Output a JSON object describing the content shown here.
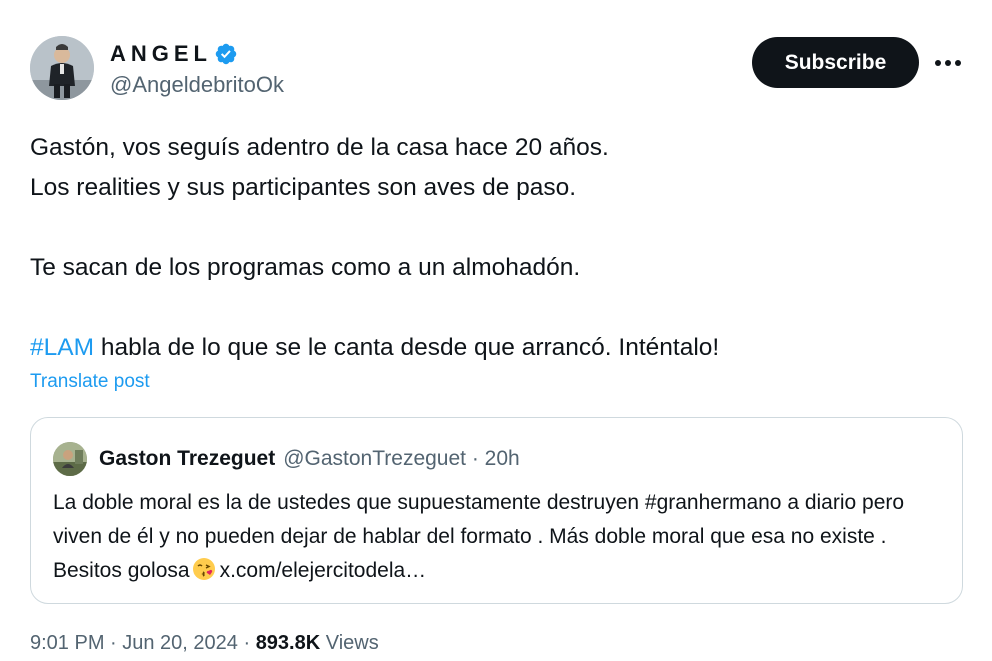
{
  "author": {
    "display_name": "ANGEL",
    "handle": "@AngeldebritoOk",
    "verified": true,
    "avatar_icon": "profile-photo-man-standing"
  },
  "actions": {
    "subscribe_label": "Subscribe",
    "more_icon": "more-horizontal-icon"
  },
  "post": {
    "lines": [
      "Gastón, vos seguís adentro de la casa hace 20 años.",
      "Los realities y sus participantes son aves de paso."
    ],
    "line3": "Te sacan de los programas como a un almohadón.",
    "hashtag": "#LAM",
    "line4_rest": " habla de lo que se le canta desde que arrancó. Inténtalo!",
    "translate_label": "Translate post"
  },
  "quote": {
    "name": "Gaston Trezeguet",
    "handle_time": "@GastonTrezeguet · 20h",
    "text_before_emoji": "La doble moral es la de ustedes que supuestamente destruyen #granhermano a diario pero viven de él y no pueden dejar de hablar del formato . Más doble moral que esa no existe . Besitos golosa",
    "emoji": "face-blowing-kiss-icon",
    "link": "x.com/elejercitodela…"
  },
  "meta": {
    "time_date": "9:01 PM · Jun 20, 2024 · ",
    "views_count": "893.8K",
    "views_label": " Views"
  },
  "colors": {
    "accent": "#1d9bf0",
    "text": "#0f1419",
    "secondary": "#536471",
    "border": "#cfd9de"
  }
}
